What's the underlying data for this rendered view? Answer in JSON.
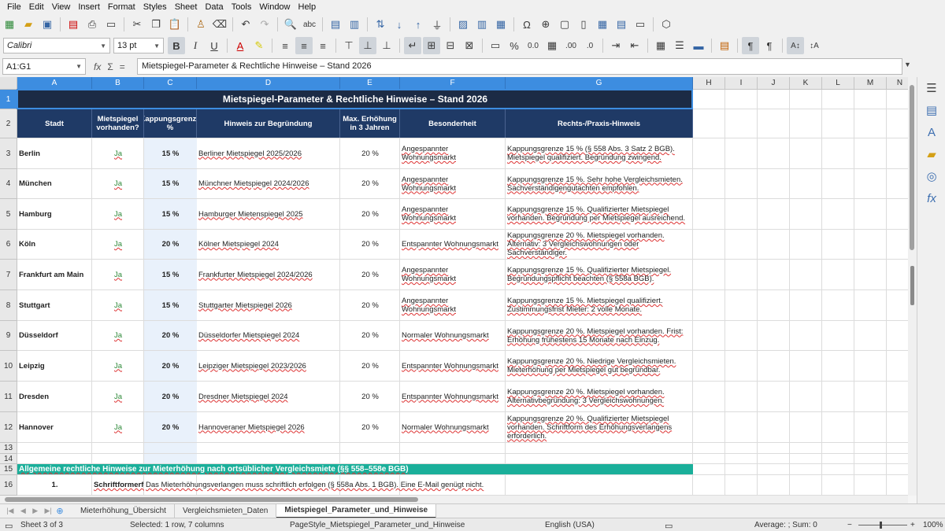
{
  "menu": [
    "File",
    "Edit",
    "View",
    "Insert",
    "Format",
    "Styles",
    "Sheet",
    "Data",
    "Tools",
    "Window",
    "Help"
  ],
  "toolbar": {
    "font_name": "Calibri",
    "font_size": "13 pt",
    "bold": "B",
    "italic": "I",
    "underline": "U",
    "percent": "%",
    "decimal_zero": "0.0",
    "decimal_add": ".00",
    "decimal_del": ".0",
    "omega": "Ω"
  },
  "formula_bar": {
    "name_box": "A1:G1",
    "fx": "fx",
    "sigma": "Σ",
    "equals": "=",
    "content": "Mietspiegel-Parameter & Rechtliche Hinweise – Stand 2026"
  },
  "columns": [
    "A",
    "B",
    "C",
    "D",
    "E",
    "F",
    "G",
    "H",
    "I",
    "J",
    "K",
    "L",
    "M",
    "N"
  ],
  "rows": [
    "1",
    "2",
    "3",
    "4",
    "5",
    "6",
    "7",
    "8",
    "9",
    "10",
    "11",
    "12",
    "13",
    "14",
    "15",
    "16"
  ],
  "sheet": {
    "title": "Mietspiegel-Parameter & Rechtliche Hinweise – Stand 2026",
    "headers": [
      "Stadt",
      "Mietspiegel vorhanden?",
      "Kappungsgrenze %",
      "Hinweis zur Begründung",
      "Max. Erhöhung in 3 Jahren",
      "Besonderheit",
      "Rechts-/Praxis-Hinweis"
    ],
    "rows": [
      {
        "stadt": "Berlin",
        "ms": "Ja",
        "kapp": "15 %",
        "hinweis": "Berliner Mietspiegel 2025/2026",
        "max": "20 %",
        "bes": "Angespannter Wohnungsmarkt",
        "recht": "Kappungsgrenze 15 % (§ 558 Abs. 3 Satz 2 BGB). Mietspiegel qualifiziert. Begründung zwingend."
      },
      {
        "stadt": "München",
        "ms": "Ja",
        "kapp": "15 %",
        "hinweis": "Münchner Mietspiegel 2024/2026",
        "max": "20 %",
        "bes": "Angespannter Wohnungsmarkt",
        "recht": "Kappungsgrenze 15 %. Sehr hohe Vergleichsmieten. Sachverständigengutachten empfohlen."
      },
      {
        "stadt": "Hamburg",
        "ms": "Ja",
        "kapp": "15 %",
        "hinweis": "Hamburger Mietenspiegel 2025",
        "max": "20 %",
        "bes": "Angespannter Wohnungsmarkt",
        "recht": "Kappungsgrenze 15 %. Qualifizierter Mietspiegel vorhanden. Begründung per Mietspiegel ausreichend."
      },
      {
        "stadt": "Köln",
        "ms": "Ja",
        "kapp": "20 %",
        "hinweis": "Kölner Mietspiegel 2024",
        "max": "20 %",
        "bes": "Entspannter Wohnungsmarkt",
        "recht": "Kappungsgrenze 20 %. Mietspiegel vorhanden. Alternativ: 3 Vergleichswohnungen oder Sachverständiger."
      },
      {
        "stadt": "Frankfurt am Main",
        "ms": "Ja",
        "kapp": "15 %",
        "hinweis": "Frankfurter Mietspiegel 2024/2026",
        "max": "20 %",
        "bes": "Angespannter Wohnungsmarkt",
        "recht": "Kappungsgrenze 15 %. Qualifizierter Mietspiegel. Begründungspflicht beachten (§ 558a BGB)."
      },
      {
        "stadt": "Stuttgart",
        "ms": "Ja",
        "kapp": "15 %",
        "hinweis": "Stuttgarter Mietspiegel 2026",
        "max": "20 %",
        "bes": "Angespannter Wohnungsmarkt",
        "recht": "Kappungsgrenze 15 %. Mietspiegel qualifiziert. Zustimmungsfrist Mieter: 2 volle Monate."
      },
      {
        "stadt": "Düsseldorf",
        "ms": "Ja",
        "kapp": "20 %",
        "hinweis": "Düsseldorfer Mietspiegel 2024",
        "max": "20 %",
        "bes": "Normaler Wohnungsmarkt",
        "recht": "Kappungsgrenze 20 %. Mietspiegel vorhanden. Frist: Erhöhung frühestens 15 Monate nach Einzug."
      },
      {
        "stadt": "Leipzig",
        "ms": "Ja",
        "kapp": "20 %",
        "hinweis": "Leipziger Mietspiegel 2023/2026",
        "max": "20 %",
        "bes": "Entspannter Wohnungsmarkt",
        "recht": "Kappungsgrenze 20 %. Niedrige Vergleichsmieten. Mieterhöhung per Mietspiegel gut begründbar."
      },
      {
        "stadt": "Dresden",
        "ms": "Ja",
        "kapp": "20 %",
        "hinweis": "Dresdner Mietspiegel 2024",
        "max": "20 %",
        "bes": "Entspannter Wohnungsmarkt",
        "recht": "Kappungsgrenze 20 %. Mietspiegel vorhanden. Alternativbegründung: 3 Vergleichswohnungen."
      },
      {
        "stadt": "Hannover",
        "ms": "Ja",
        "kapp": "20 %",
        "hinweis": "Hannoveraner Mietspiegel 2026",
        "max": "20 %",
        "bes": "Normaler Wohnungsmarkt",
        "recht": "Kappungsgrenze 20 %. Qualifizierter Mietspiegel vorhanden. Schriftform des Erhöhungsverlangens erforderlich."
      }
    ],
    "section_header": "Allgemeine rechtliche Hinweise zur Mieterhöhung nach ortsüblicher Vergleichsmiete (§§ 558–558e BGB)",
    "row16": {
      "num": "1.",
      "label": "Schriftformerfordernis:",
      "text": "Das Mieterhöhungsverlangen muss schriftlich erfolgen (§ 558a Abs. 1 BGB). Eine E-Mail genügt nicht."
    }
  },
  "tabs": [
    "Mieterhöhung_Übersicht",
    "Vergleichsmieten_Daten",
    "Mietspiegel_Parameter_und_Hinweise"
  ],
  "active_tab": 2,
  "status": {
    "sheet": "Sheet 3 of 3",
    "selection": "Selected: 1 row, 7 columns",
    "pagestyle": "PageStyle_Mietspiegel_Parameter_und_Hinweise",
    "language": "English (USA)",
    "summary": "Average: ; Sum: 0",
    "zoom": "100%"
  },
  "colors": {
    "title_bg": "#1c2b45",
    "header_bg": "#1f3a66",
    "teal": "#1aaf9a",
    "selection": "#3d8de0"
  }
}
